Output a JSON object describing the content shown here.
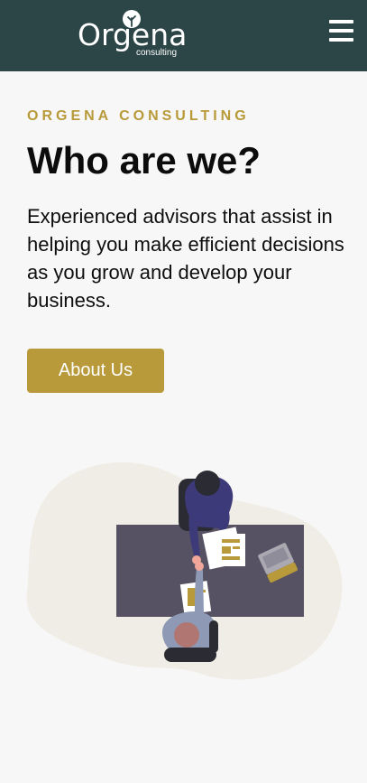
{
  "header": {
    "logo_word": "Orgena",
    "logo_sub": "consulting",
    "menu_icon": "hamburger-menu-icon"
  },
  "hero": {
    "eyebrow": "ORGENA CONSULTING",
    "title": "Who are we?",
    "description": "Experienced advisors that assist in helping you make efficient decisions as you grow and develop your business.",
    "cta_label": "About Us"
  },
  "colors": {
    "header_bg": "#2c4547",
    "accent_gold": "#b89a3a",
    "page_bg": "#f7f7f7",
    "text": "#0c0c0c"
  },
  "illustration": {
    "icon": "business-handshake-illustration"
  }
}
